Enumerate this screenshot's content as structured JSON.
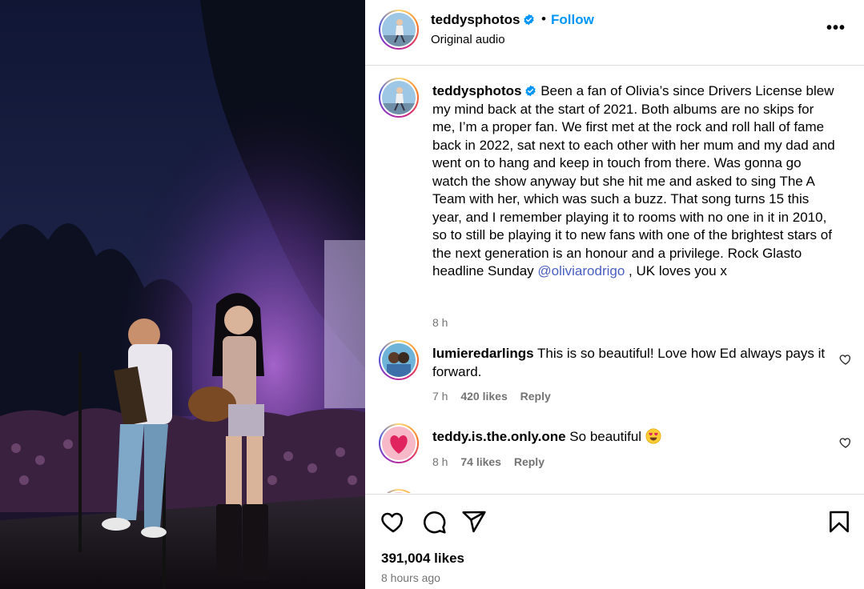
{
  "post": {
    "username": "teddysphotos",
    "follow_label": "Follow",
    "separator": "•",
    "audio": "Original audio",
    "more_label": "•••",
    "caption_parts": {
      "before": "Been a fan of Olivia’s since Drivers License blew my mind back at the start of 2021. Both albums are no skips for me, I’m a proper fan. We first met at the rock and roll hall of fame back in 2022, sat next to each other with her mum and my dad and went on to hang and keep in touch from there. Was gonna go watch the show anyway but she hit me and asked to sing The A Team with her, which was such a buzz. That song turns 15 this year, and I remember playing it to rooms with no one in it in 2010, so to still be playing it to new fans with one of the brightest stars of the next generation is an honour and a privilege. Rock Glasto headline Sunday ",
      "mention": "@oliviarodrigo",
      "after": " , UK loves you x"
    },
    "caption_age": "8 h",
    "likes": "391,004 likes",
    "posted": "8 hours ago"
  },
  "comments": [
    {
      "username": "lumieredarlings",
      "text": "This is so beautiful! Love how Ed always pays it forward.",
      "age": "7 h",
      "likes": "420 likes",
      "reply_label": "Reply"
    },
    {
      "username": "teddy.is.the.only.one",
      "text": "So beautiful",
      "emoji": "heart-eyes-emoji",
      "age": "8 h",
      "likes": "74 likes",
      "reply_label": "Reply"
    }
  ],
  "icons": {
    "verified": "verified-badge-icon",
    "like": "heart-icon",
    "comment": "comment-icon",
    "share": "paper-plane-icon",
    "save": "bookmark-icon"
  },
  "colors": {
    "link": "#0095f6",
    "verified": "#0095f6",
    "secondary_text": "#737373",
    "divider": "#dbdbdb"
  }
}
